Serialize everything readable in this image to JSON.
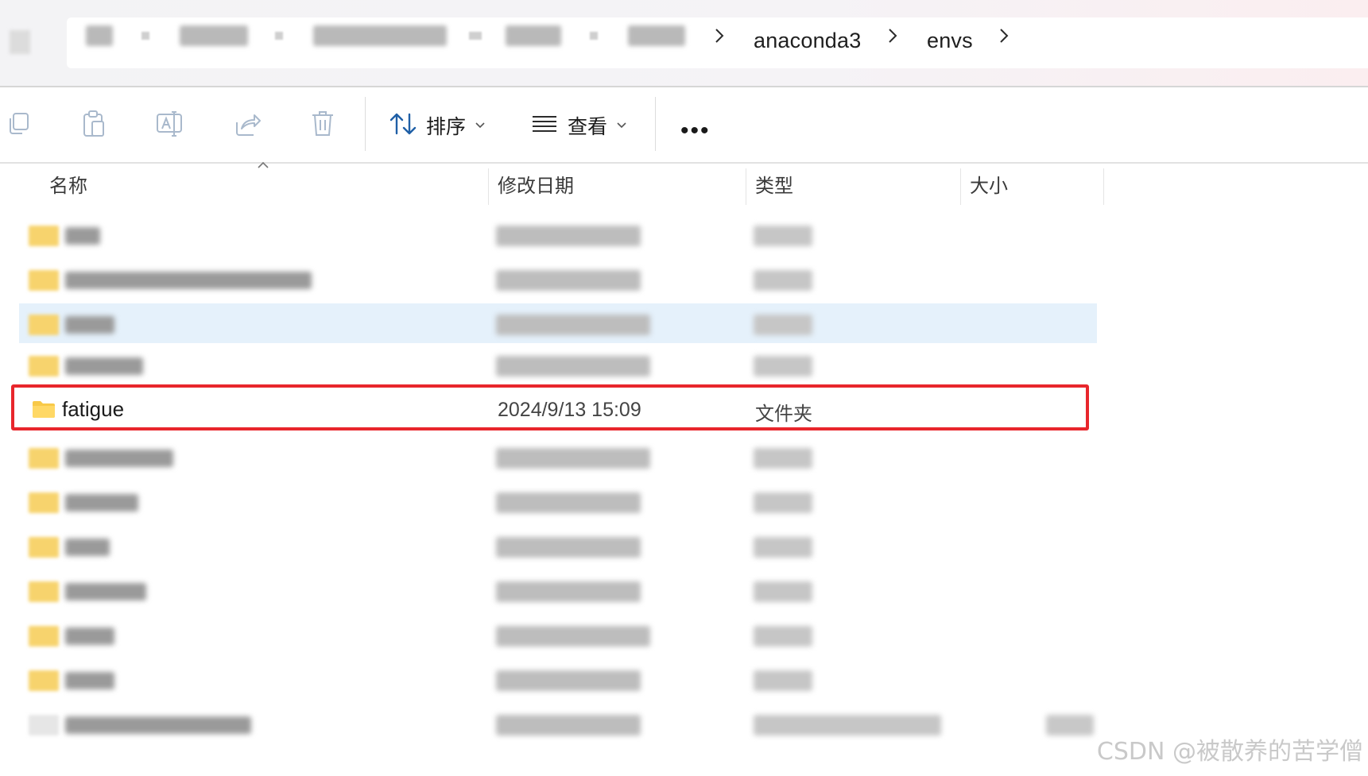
{
  "address_bar": {
    "segments": [
      "anaconda3",
      "envs"
    ],
    "separator_icon": "chevron-right-icon"
  },
  "toolbar": {
    "sort_label": "排序",
    "view_label": "查看",
    "icons": [
      "copy-icon",
      "paste-icon",
      "rename-icon",
      "share-icon",
      "delete-icon",
      "sort-icon",
      "view-list-icon",
      "more-icon"
    ],
    "more_label": "•••"
  },
  "columns": {
    "name": "名称",
    "modified": "修改日期",
    "type": "类型",
    "size": "大小"
  },
  "highlighted_item": {
    "name": "fatigue",
    "modified": "2024/9/13 15:09",
    "type": "文件夹",
    "icon": "folder-icon",
    "highlight_color": "#e8262c"
  },
  "selected_row_color": "#e5f1fb",
  "watermark": "CSDN @被散养的苦学僧"
}
